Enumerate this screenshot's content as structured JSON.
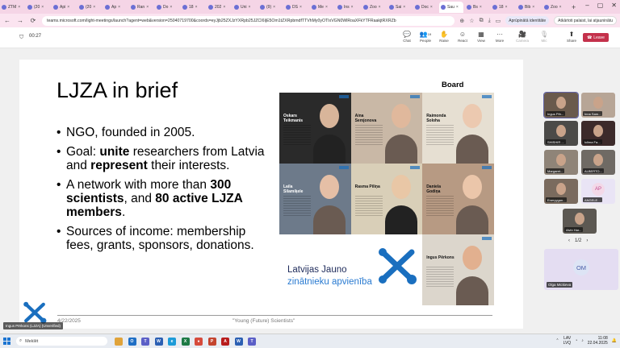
{
  "browser": {
    "tabs": [
      {
        "label": "ZTM"
      },
      {
        "label": "(20"
      },
      {
        "label": "Api"
      },
      {
        "label": "(20"
      },
      {
        "label": "Ap"
      },
      {
        "label": "Ran"
      },
      {
        "label": "Do"
      },
      {
        "label": "18"
      },
      {
        "label": "202"
      },
      {
        "label": "Uni"
      },
      {
        "label": "(9)"
      },
      {
        "label": "DS"
      },
      {
        "label": "Me"
      },
      {
        "label": "Ins"
      },
      {
        "label": "Zoo"
      },
      {
        "label": "Sai"
      },
      {
        "label": "Doc"
      },
      {
        "label": "Sau"
      },
      {
        "label": "Bs"
      },
      {
        "label": "18"
      },
      {
        "label": "Bib"
      },
      {
        "label": "Zoo"
      }
    ],
    "active_tab_index": 17,
    "new_tab": "+",
    "url": "teams.microsoft.com/light-meetings/launch?agent=web&version=25040719700&coords=eyJjb25ZXJzYXRpb25JZCI6IjE5Om1tZXRpbmdfTTVhMy0yOTIxVGN0WlRoaXFkYTFRaakjtRXRZb",
    "profile_pill": "Aprūpinātā identitāte",
    "other_window_pill": "Atkārtoti palaist, lai atjauninātu"
  },
  "teams": {
    "timer": "00:27",
    "controls": [
      {
        "id": "chat",
        "label": "Chat",
        "icon": "chat-icon",
        "glyph": "💬",
        "disabled": false
      },
      {
        "id": "people",
        "label": "People",
        "icon": "people-icon",
        "glyph": "👥",
        "count": "19",
        "disabled": false
      },
      {
        "id": "raise",
        "label": "Raise",
        "icon": "raise-hand-icon",
        "glyph": "✋",
        "disabled": false
      },
      {
        "id": "react",
        "label": "React",
        "icon": "react-icon",
        "glyph": "☺",
        "disabled": false
      },
      {
        "id": "view",
        "label": "View",
        "icon": "view-icon",
        "glyph": "▦",
        "disabled": false
      },
      {
        "id": "more",
        "label": "More",
        "icon": "more-icon",
        "glyph": "···",
        "disabled": false
      },
      {
        "id": "camera",
        "label": "Camera",
        "icon": "camera-icon",
        "glyph": "🎥",
        "disabled": true
      },
      {
        "id": "mic",
        "label": "Mic",
        "icon": "mic-icon",
        "glyph": "🎙",
        "disabled": true
      },
      {
        "id": "share",
        "label": "Share",
        "icon": "share-icon",
        "glyph": "⬆",
        "disabled": false
      }
    ],
    "leave_label": "Leave"
  },
  "slide": {
    "title": "LJZA in brief",
    "bullets": [
      [
        {
          "t": "NGO, founded in 2005.",
          "b": false
        }
      ],
      [
        {
          "t": "Goal: ",
          "b": false
        },
        {
          "t": "unite",
          "b": true
        },
        {
          "t": " researchers from Latvia and ",
          "b": false
        },
        {
          "t": "represent",
          "b": true
        },
        {
          "t": " their interests.",
          "b": false
        }
      ],
      [
        {
          "t": "A network with more than ",
          "b": false
        },
        {
          "t": "300 scientists",
          "b": true
        },
        {
          "t": ", and ",
          "b": false
        },
        {
          "t": "80 active LJZA members",
          "b": true
        },
        {
          "t": ".",
          "b": false
        }
      ],
      [
        {
          "t": "Sources of income: membership fees, grants, sponsors, donations.",
          "b": false
        }
      ]
    ],
    "board_label": "Board",
    "board": [
      {
        "name": "Oskars Teikmanis",
        "bg": "#2a2a2a",
        "skin": "#d8b59a"
      },
      {
        "name": "Aina Semjonova",
        "bg": "#c9b8a6",
        "skin": "#e0b89c"
      },
      {
        "name": "Raimonda Soloha",
        "bg": "#e6dfd2",
        "skin": "#ecc9b0"
      },
      {
        "name": "Laila Silamiķele",
        "bg": "#6d7a8a",
        "skin": "#e5bfa6"
      },
      {
        "name": "Rasma Piliņa",
        "bg": "#d9cfb8",
        "skin": "#e9c7a6"
      },
      {
        "name": "Daniela Godiņa",
        "bg": "#b79a83",
        "skin": "#ebc6aa"
      },
      {
        "name": "Ingus Pērkons",
        "bg": "#dcd6cc",
        "skin": "#e2b08f"
      }
    ],
    "brand_line1": "Latvijas Jauno",
    "brand_line2": "zinātnieku apvienība",
    "date": "4/22/2025",
    "footer": "\"Young (Future) Scientists\"",
    "accent": "#1a6fbf"
  },
  "self_view": {
    "name": "Ingus Pērkons (LJZA) (Unverified)"
  },
  "participants": [
    {
      "name": "Ingus Pēr...",
      "selected": true,
      "bg": "#6a5a4c"
    },
    {
      "name": "Inna Sam...",
      "selected": false,
      "bg": "#b7a596"
    },
    {
      "name": "SHISHIR ...",
      "selected": false,
      "bg": "#4b4a48"
    },
    {
      "name": "Iclima Fa...",
      "selected": false,
      "bg": "#3c2a2a"
    },
    {
      "name": "Margaret...",
      "selected": false,
      "bg": "#8f8478"
    },
    {
      "name": "ALBERTO...",
      "selected": false,
      "bg": "#6f6a64"
    },
    {
      "name": "Eneryygan...",
      "selected": false,
      "bg": "#7a6b5e"
    },
    {
      "name": "ANGELE...",
      "selected": false,
      "initials": "AP"
    },
    {
      "name": "Alvin Har...",
      "selected": false,
      "bg": "#5c5852"
    }
  ],
  "pager": {
    "label": "1/2",
    "prev": "‹",
    "next": "›"
  },
  "big_participant": {
    "initials": "OM",
    "name": "Olga Mickieva"
  },
  "taskbar": {
    "search_placeholder": "Meklēt",
    "apps": [
      {
        "name": "explorer",
        "color": "#e0a33a",
        "glyph": ""
      },
      {
        "name": "outlook",
        "color": "#1f6fc5",
        "glyph": "O"
      },
      {
        "name": "teams",
        "color": "#5b5fc7",
        "glyph": "T"
      },
      {
        "name": "word",
        "color": "#2b5fb3",
        "glyph": "W"
      },
      {
        "name": "edge",
        "color": "#1d9bd8",
        "glyph": "e"
      },
      {
        "name": "excel",
        "color": "#1d7a45",
        "glyph": "X"
      },
      {
        "name": "chrome",
        "color": "#d64b3c",
        "glyph": "●"
      },
      {
        "name": "powerpoint",
        "color": "#c4452f",
        "glyph": "P"
      },
      {
        "name": "acrobat",
        "color": "#b81d1d",
        "glyph": "A"
      },
      {
        "name": "word2",
        "color": "#2b5fb3",
        "glyph": "W"
      },
      {
        "name": "teams2",
        "color": "#5b5fc7",
        "glyph": "T"
      }
    ],
    "lang": "LAV",
    "lang2": "LVQ",
    "time": "11:08",
    "date": "22.04.2025"
  }
}
